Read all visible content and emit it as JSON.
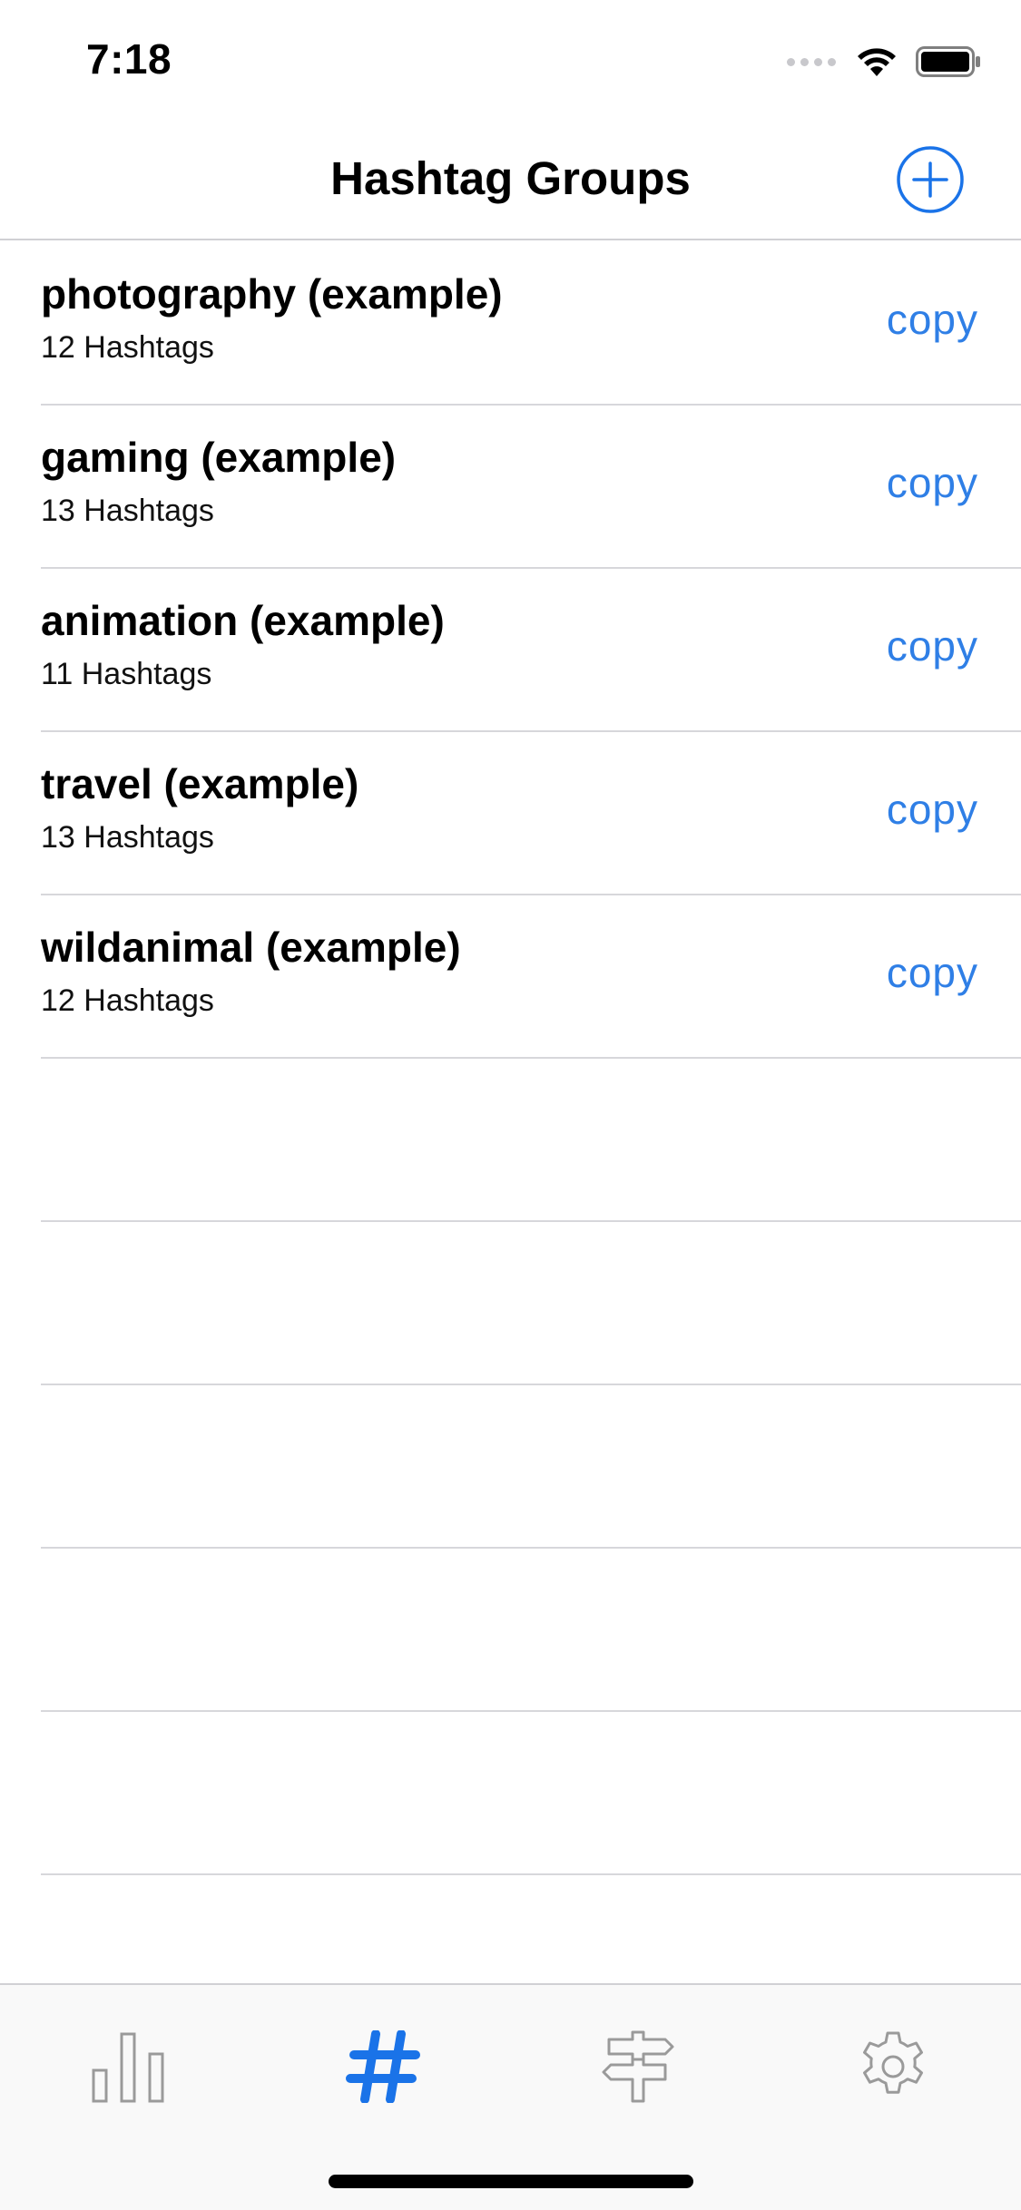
{
  "status_bar": {
    "time": "7:18"
  },
  "nav": {
    "title": "Hashtag Groups",
    "add_icon": "plus-circle-icon"
  },
  "groups": [
    {
      "title": "photography (example)",
      "subtitle": "12 Hashtags",
      "action": "copy"
    },
    {
      "title": "gaming (example)",
      "subtitle": "13 Hashtags",
      "action": "copy"
    },
    {
      "title": "animation (example)",
      "subtitle": "11 Hashtags",
      "action": "copy"
    },
    {
      "title": "travel (example)",
      "subtitle": "13 Hashtags",
      "action": "copy"
    },
    {
      "title": "wildanimal (example)",
      "subtitle": "12 Hashtags",
      "action": "copy"
    }
  ],
  "tabs": [
    {
      "icon": "bar-chart-icon",
      "selected": false
    },
    {
      "icon": "hashtag-icon",
      "selected": true
    },
    {
      "icon": "signpost-icon",
      "selected": false
    },
    {
      "icon": "gear-icon",
      "selected": false
    }
  ],
  "colors": {
    "accent": "#1a73e8",
    "copy": "#2f7fe6",
    "inactive": "#9a9a9a"
  }
}
